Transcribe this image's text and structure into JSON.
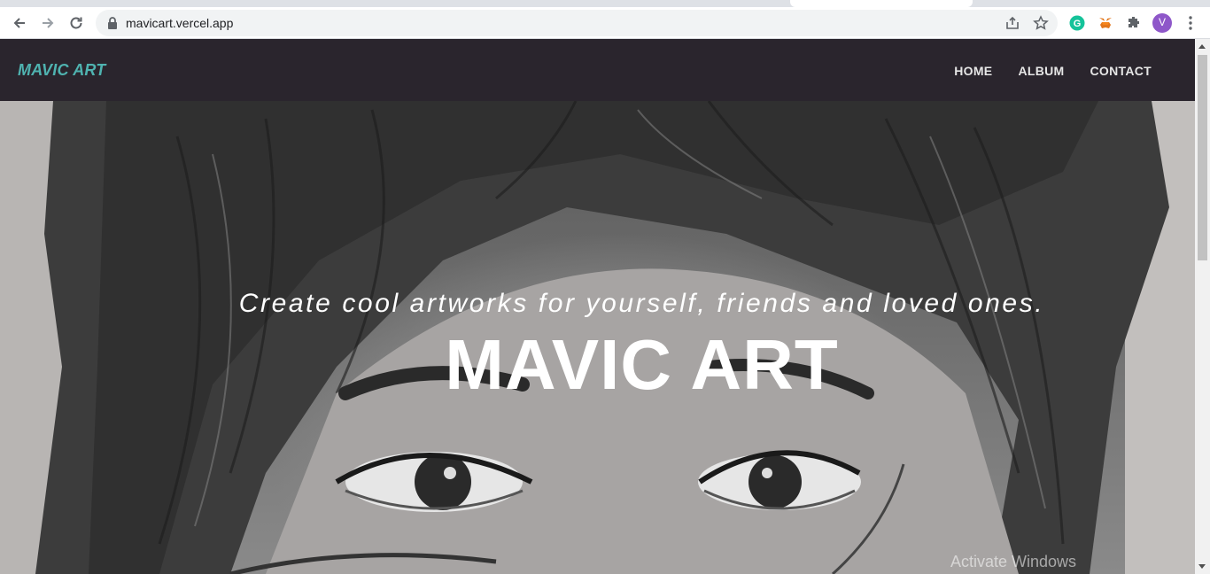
{
  "browser": {
    "url": "mavicart.vercel.app",
    "profile_initial": "V",
    "icons": [
      "back-icon",
      "forward-icon",
      "reload-icon",
      "lock-icon",
      "share-icon",
      "star-icon",
      "grammarly-icon",
      "metamask-icon",
      "extensions-icon",
      "menu-icon"
    ]
  },
  "site": {
    "brand": "MAVIC ART",
    "nav": [
      {
        "label": "HOME"
      },
      {
        "label": "ALBUM"
      },
      {
        "label": "CONTACT"
      }
    ],
    "hero": {
      "subtitle": "Create cool artworks for yourself, friends and loved ones.",
      "title": "MAVIC ART"
    },
    "colors": {
      "navbar": "#2a252d",
      "brand": "#4fb3b0",
      "nav_text": "#e6e6e6"
    }
  },
  "os": {
    "watermark": "Activate Windows"
  }
}
